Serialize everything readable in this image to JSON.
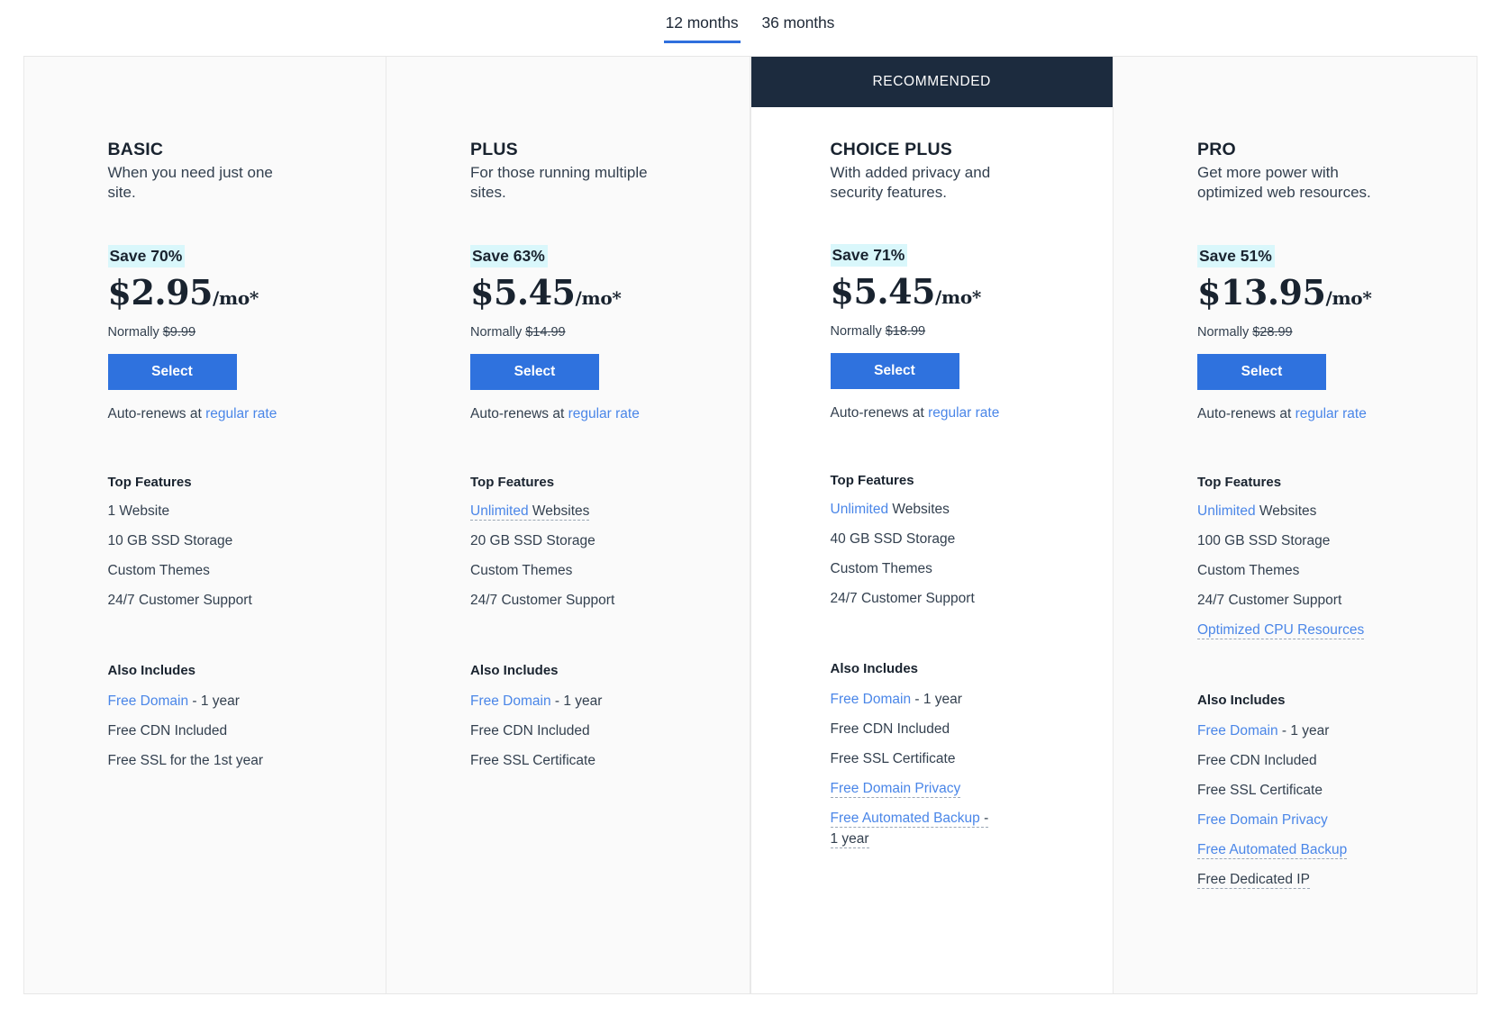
{
  "terms": {
    "options": [
      {
        "label": "12 months",
        "active": true
      },
      {
        "label": "36 months",
        "active": false
      }
    ]
  },
  "colors": {
    "accent_blue": "#2f72de",
    "link_blue": "#4a86e8",
    "ribbon_navy": "#1c2b3e",
    "save_highlight": "#d9f7fb",
    "card_bg": "#fafafa",
    "featured_bg": "#ffffff",
    "text_dark": "#19232f",
    "text_body": "#33404f"
  },
  "labels": {
    "top_features": "Top Features",
    "also_includes": "Also Includes",
    "select": "Select",
    "autorenew_prefix": "Auto-renews at ",
    "autorenew_link": "regular rate",
    "normally_prefix": "Normally ",
    "recommended": "RECOMMENDED"
  },
  "plans": [
    {
      "name": "BASIC",
      "tagline": "When you need just one site.",
      "save": "Save 70%",
      "price": "$2.95",
      "per": "/mo*",
      "normally": "$9.99",
      "featured": false,
      "features": [
        {
          "text": "1 Website",
          "link": "",
          "tip": false
        },
        {
          "text": "10 GB SSD Storage",
          "link": "",
          "tip": false
        },
        {
          "text": "Custom Themes",
          "link": "",
          "tip": false
        },
        {
          "text": "24/7 Customer Support",
          "link": "",
          "tip": false
        }
      ],
      "includes": [
        {
          "link": "Free Domain",
          "text": " - 1 year",
          "tip": false
        },
        {
          "link": "",
          "text": "Free CDN Included",
          "tip": false
        },
        {
          "link": "",
          "text": "Free SSL for the 1st year",
          "tip": false
        }
      ]
    },
    {
      "name": "PLUS",
      "tagline": "For those running multiple sites.",
      "save": "Save 63%",
      "price": "$5.45",
      "per": "/mo*",
      "normally": "$14.99",
      "featured": false,
      "features": [
        {
          "link": "Unlimited",
          "text": " Websites",
          "tip": true
        },
        {
          "link": "",
          "text": "20 GB SSD Storage",
          "tip": false
        },
        {
          "link": "",
          "text": "Custom Themes",
          "tip": false
        },
        {
          "link": "",
          "text": "24/7 Customer Support",
          "tip": false
        }
      ],
      "includes": [
        {
          "link": "Free Domain",
          "text": " - 1 year",
          "tip": false
        },
        {
          "link": "",
          "text": "Free CDN Included",
          "tip": false
        },
        {
          "link": "",
          "text": "Free SSL Certificate",
          "tip": false
        }
      ]
    },
    {
      "name": "CHOICE PLUS",
      "tagline": "With added privacy and security features.",
      "save": "Save 71%",
      "price": "$5.45",
      "per": "/mo*",
      "normally": "$18.99",
      "featured": true,
      "ribbon": "RECOMMENDED",
      "features": [
        {
          "link": "Unlimited",
          "text": " Websites",
          "tip": false
        },
        {
          "link": "",
          "text": "40 GB SSD Storage",
          "tip": false
        },
        {
          "link": "",
          "text": "Custom Themes",
          "tip": false
        },
        {
          "link": "",
          "text": "24/7 Customer Support",
          "tip": false
        }
      ],
      "includes": [
        {
          "link": "Free Domain",
          "text": " - 1 year",
          "tip": false
        },
        {
          "link": "",
          "text": "Free CDN Included",
          "tip": false
        },
        {
          "link": "",
          "text": "Free SSL Certificate",
          "tip": false
        },
        {
          "link": "Free Domain Privacy",
          "text": "",
          "tip": true
        },
        {
          "link": "Free Automated Backup",
          "text": " - 1 year",
          "tip": true
        }
      ]
    },
    {
      "name": "PRO",
      "tagline": "Get more power with optimized web resources.",
      "save": "Save 51%",
      "price": "$13.95",
      "per": "/mo*",
      "normally": "$28.99",
      "featured": false,
      "features": [
        {
          "link": "Unlimited",
          "text": " Websites",
          "tip": false
        },
        {
          "link": "",
          "text": "100 GB SSD Storage",
          "tip": false
        },
        {
          "link": "",
          "text": "Custom Themes",
          "tip": false
        },
        {
          "link": "",
          "text": "24/7 Customer Support",
          "tip": false
        },
        {
          "link": "Optimized CPU Resources",
          "text": "",
          "tip": true
        }
      ],
      "includes": [
        {
          "link": "Free Domain",
          "text": " - 1 year",
          "tip": false
        },
        {
          "link": "",
          "text": "Free CDN Included",
          "tip": false
        },
        {
          "link": "",
          "text": "Free SSL Certificate",
          "tip": false
        },
        {
          "link": "Free Domain Privacy",
          "text": "",
          "tip": false
        },
        {
          "link": "Free Automated Backup",
          "text": "",
          "tip": true
        },
        {
          "link": "",
          "text": "Free Dedicated IP",
          "tip": true
        }
      ]
    }
  ]
}
